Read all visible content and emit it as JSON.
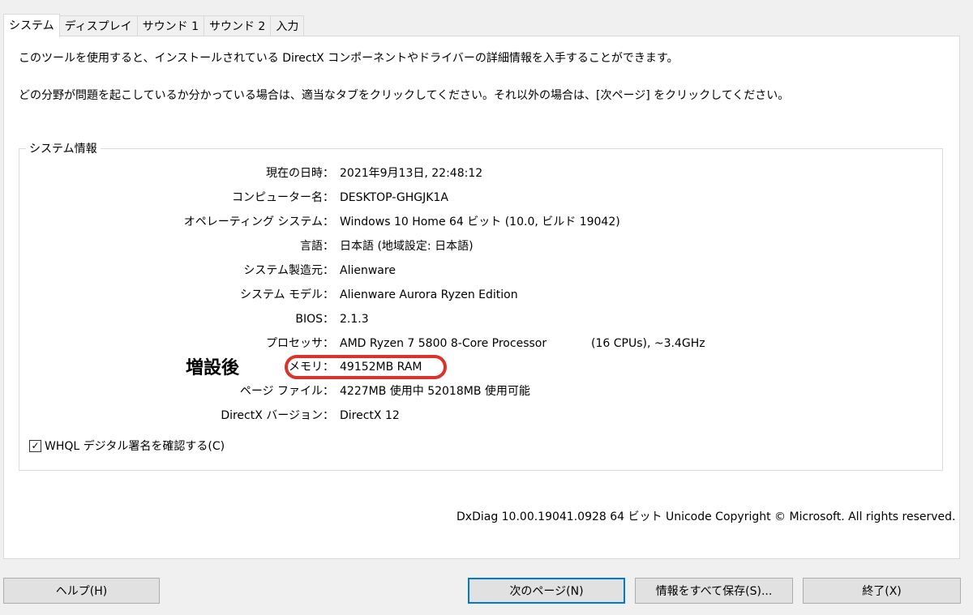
{
  "tabs": [
    {
      "label": "システム"
    },
    {
      "label": "ディスプレイ"
    },
    {
      "label": "サウンド 1"
    },
    {
      "label": "サウンド 2"
    },
    {
      "label": "入力"
    }
  ],
  "intro": {
    "line1": "このツールを使用すると、インストールされている DirectX コンポーネントやドライバーの詳細情報を入手することができます。",
    "line2": "どの分野が問題を起こしているか分かっている場合は、適当なタブをクリックしてください。それ以外の場合は、[次ページ] をクリックしてください。"
  },
  "system_info": {
    "title": "システム情報",
    "rows": [
      {
        "label": "現在の日時：",
        "value": "2021年9月13日, 22:48:12"
      },
      {
        "label": "コンピューター名：",
        "value": "DESKTOP-GHGJK1A"
      },
      {
        "label": "オペレーティング システム：",
        "value": "Windows 10 Home 64 ビット (10.0, ビルド 19042)"
      },
      {
        "label": "言語：",
        "value": "日本語 (地域設定: 日本語)"
      },
      {
        "label": "システム製造元：",
        "value": "Alienware"
      },
      {
        "label": "システム モデル：",
        "value": "Alienware Aurora Ryzen Edition"
      },
      {
        "label": "BIOS：",
        "value": "2.1.3"
      },
      {
        "label": "プロセッサ：",
        "value": "AMD Ryzen 7 5800 8-Core Processor",
        "value2": "(16 CPUs), ~3.4GHz"
      },
      {
        "label": "メモリ：",
        "value": "49152MB RAM"
      },
      {
        "label": "ページ ファイル：",
        "value": "4227MB 使用中 52018MB 使用可能"
      },
      {
        "label": "DirectX バージョン：",
        "value": "DirectX 12"
      }
    ]
  },
  "annotation": {
    "text": "増設後",
    "ring_color": "#d9332b"
  },
  "whql": {
    "label": "WHQL デジタル署名を確認する(C)",
    "checked": true,
    "check_glyph": "✓"
  },
  "footer_info": "DxDiag 10.00.19041.0928 64 ビット Unicode  Copyright © Microsoft. All rights reserved.",
  "buttons": {
    "help": "ヘルプ(H)",
    "next": "次のページ(N)",
    "save": "情報をすべて保存(S)...",
    "exit": "終了(X)"
  },
  "colors": {
    "default_button_border": "#0078d7",
    "panel_bg": "#ffffff",
    "window_bg": "#f0f0f0"
  }
}
